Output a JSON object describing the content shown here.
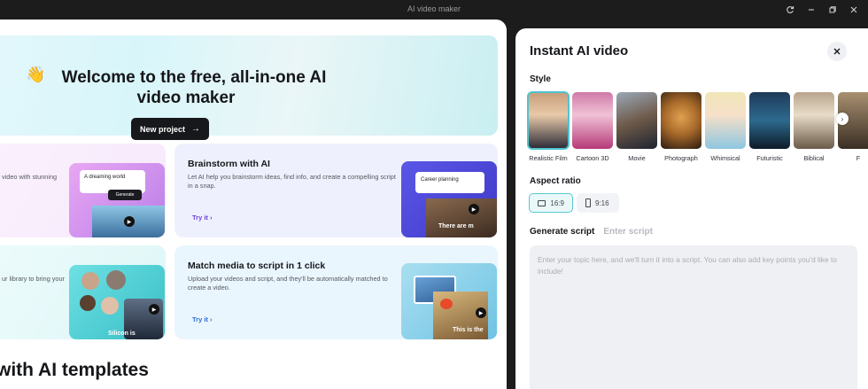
{
  "window": {
    "title": "AI video maker"
  },
  "hero": {
    "wave": "👋",
    "title": "Welcome to the free, all-in-one AI video maker",
    "new_project_label": "New project"
  },
  "cards": [
    {
      "title": "",
      "desc": "video with stunning",
      "overlay1": "A dreaming world",
      "overlay2": "Generate"
    },
    {
      "title": "Brainstorm with AI",
      "desc": "Let AI help you brainstorm ideas, find info, and create a compelling script in a snap.",
      "try": "Try it",
      "overlay1": "Career planning",
      "overlay2": "There are m"
    },
    {
      "title": "",
      "desc": "ur library to bring your",
      "overlay1": "Silicon is"
    },
    {
      "title": "Match media to script in 1 click",
      "desc": "Upload your videos and script, and they'll be automatically matched to create a video.",
      "try": "Try it",
      "overlay1": "This is the"
    }
  ],
  "section_title": "with AI templates",
  "panel": {
    "title": "Instant AI video",
    "style_label": "Style",
    "styles": [
      {
        "name": "Realistic Film",
        "selected": true
      },
      {
        "name": "Cartoon 3D",
        "selected": false
      },
      {
        "name": "Movie",
        "selected": false
      },
      {
        "name": "Photograph",
        "selected": false
      },
      {
        "name": "Whimsical",
        "selected": false
      },
      {
        "name": "Futuristic",
        "selected": false
      },
      {
        "name": "Biblical",
        "selected": false
      },
      {
        "name": "F",
        "selected": false
      }
    ],
    "aspect_label": "Aspect ratio",
    "ratios": [
      {
        "label": "16:9",
        "selected": true
      },
      {
        "label": "9:16",
        "selected": false
      }
    ],
    "tabs": [
      "Generate script",
      "Enter script"
    ],
    "script_placeholder": "Enter your topic here, and we'll turn it into a script. You can also add key points you'd like to include!"
  },
  "colors": {
    "accent": "#4fc4d0",
    "dark_button": "#17181c",
    "purple_link": "#6a3fd8"
  }
}
